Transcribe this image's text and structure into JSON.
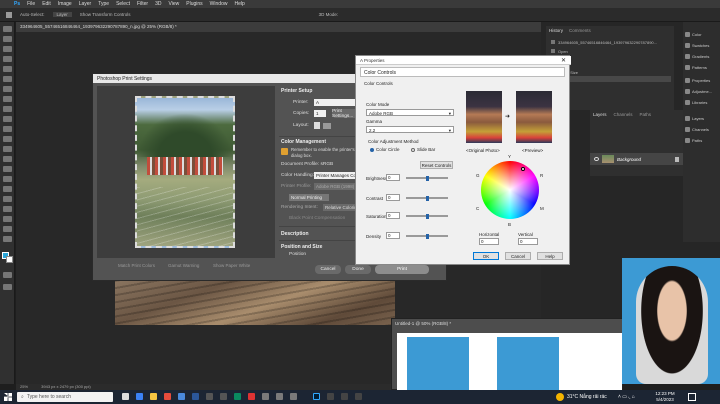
{
  "menu": [
    "Ps",
    "File",
    "Edit",
    "Image",
    "Layer",
    "Type",
    "Select",
    "Filter",
    "3D",
    "View",
    "Plugins",
    "Window",
    "Help"
  ],
  "options_bar": {
    "auto_select": "Auto-Select:",
    "layer_label": "Layer",
    "transform": "Show Transform Controls",
    "mode3d": "3D Mode:"
  },
  "doc_tab": "334964605_55746516846464_193979632290787890_n.jpg @ 25% (RGB/8) *",
  "status": {
    "zoom": "25%",
    "size": "3943 px x 2479 px (300 ppi)"
  },
  "history": {
    "tabs": [
      "History",
      "Comments"
    ],
    "items": [
      "334964605_55746516846464_193979632290787890...",
      "Open",
      "Levels",
      "Crop",
      "Image Size",
      "Levels"
    ]
  },
  "right_panel": {
    "items": [
      "Color",
      "Swatches",
      "Gradients",
      "Patterns",
      "Properties",
      "Adjustme...",
      "Libraries",
      "Layers",
      "Channels",
      "Paths"
    ]
  },
  "layers": {
    "tabs": [
      "Layers",
      "Channels",
      "Paths"
    ],
    "layer_name": "Background"
  },
  "print_dialog": {
    "title": "Photoshop Print Settings",
    "printer_setup": "Printer Setup",
    "printer_label": "Printer:",
    "printer_value": "A",
    "copies_label": "Copies:",
    "copies_value": "1",
    "print_settings_btn": "Print Settings...",
    "layout_label": "Layout:",
    "color_mgmt": "Color Management",
    "remember_note": "Remember to enable the printer's color management in the print settings dialog box.",
    "doc_profile": "Document Profile: sRGB",
    "color_handling_label": "Color Handling:",
    "color_handling_value": "Printer Manages Colors",
    "printer_profile_label": "Printer Profile:",
    "printer_profile_value": "Adobe RGB (1998)",
    "normal_printing": "Normal Printing",
    "rendering_intent_label": "Rendering Intent:",
    "rendering_intent_value": "Relative Colorimetric",
    "black_point": "Black Point Compensation",
    "description": "Description",
    "position_size": "Position and Size",
    "position": "Position",
    "match_colors": "Match Print Colors",
    "gamut_warning": "Gamut Warning",
    "show_paper_white": "Show Paper White",
    "cancel": "Cancel",
    "done": "Done",
    "print": "Print"
  },
  "properties_window": {
    "title": "A Properties",
    "color_controls_tab": "Color Controls",
    "color_controls_heading": "Color Controls",
    "color_mode_label": "Color Mode",
    "color_mode_value": "Adobe RGB",
    "gamma_label": "Gamma",
    "gamma_value": "2.2",
    "adjustment_method": "Color Adjustment Method",
    "color_circle": "Color Circle",
    "slide_bar": "Slide Bar",
    "reset": "Reset Controls",
    "original": "<Original Photo>",
    "preview": "<Preview>",
    "sliders": [
      {
        "label": "Brightness",
        "value": "0"
      },
      {
        "label": "Contrast",
        "value": "0"
      },
      {
        "label": "Saturation",
        "value": "0"
      },
      {
        "label": "Density",
        "value": "0"
      }
    ],
    "wheel_letters": [
      "Y",
      "R",
      "M",
      "B",
      "C",
      "G"
    ],
    "horizontal_label": "Horizontal",
    "horizontal_value": "0",
    "vertical_label": "Vertical",
    "vertical_value": "0",
    "ok": "OK",
    "cancel": "Cancel",
    "help": "Help"
  },
  "bottom_doc": {
    "title": "Untitled-1 @ 50% (RGB/8) *"
  },
  "taskbar": {
    "search_placeholder": "Type here to search",
    "weather": "31°C  Nắng rải rác",
    "time": "12:23 PM",
    "date": "5/4/2023"
  },
  "colors": {
    "accent": "#2563a8",
    "ps_bg": "#1e1e1e",
    "photo_blue": "#3c9ad4"
  }
}
